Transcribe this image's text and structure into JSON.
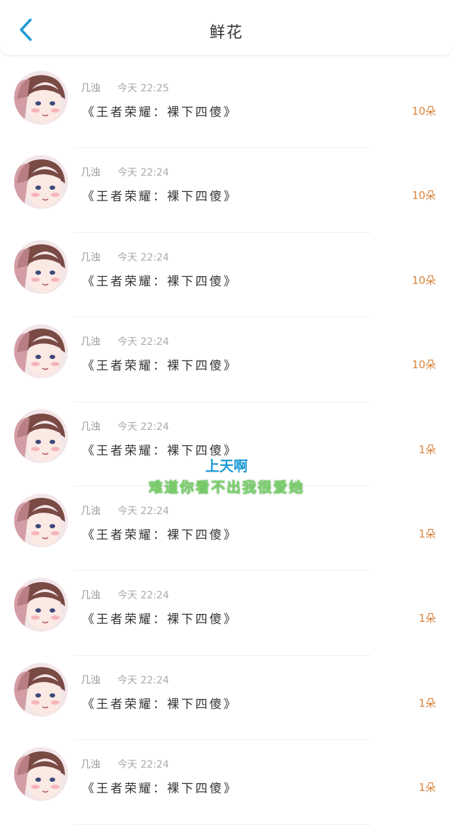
{
  "header": {
    "title": "鲜花",
    "back_icon": "chevron-left-icon",
    "accent_color": "#1e9ad6"
  },
  "items": [
    {
      "name": "几浊",
      "time": "今天 22:25",
      "game": "《王者荣耀：裸下四傻》",
      "count": "10朵"
    },
    {
      "name": "几浊",
      "time": "今天 22:24",
      "game": "《王者荣耀：裸下四傻》",
      "count": "10朵"
    },
    {
      "name": "几浊",
      "time": "今天 22:24",
      "game": "《王者荣耀：裸下四傻》",
      "count": "10朵"
    },
    {
      "name": "几浊",
      "time": "今天 22:24",
      "game": "《王者荣耀：裸下四傻》",
      "count": "10朵"
    },
    {
      "name": "几浊",
      "time": "今天 22:24",
      "game": "《王者荣耀：裸下四傻》",
      "count": "1朵"
    },
    {
      "name": "几浊",
      "time": "今天 22:24",
      "game": "《王者荣耀：裸下四傻》",
      "count": "1朵"
    },
    {
      "name": "几浊",
      "time": "今天 22:24",
      "game": "《王者荣耀：裸下四傻》",
      "count": "1朵"
    },
    {
      "name": "几浊",
      "time": "今天 22:24",
      "game": "《王者荣耀：裸下四傻》",
      "count": "1朵"
    },
    {
      "name": "几浊",
      "time": "今天 22:24",
      "game": "《王者荣耀：裸下四傻》",
      "count": "1朵"
    }
  ],
  "overlay": {
    "line1": "上天啊",
    "line2": "难道你看不出我很爱她",
    "line1_color": "#1e9ad6",
    "line2_color": "#7dd26a"
  }
}
